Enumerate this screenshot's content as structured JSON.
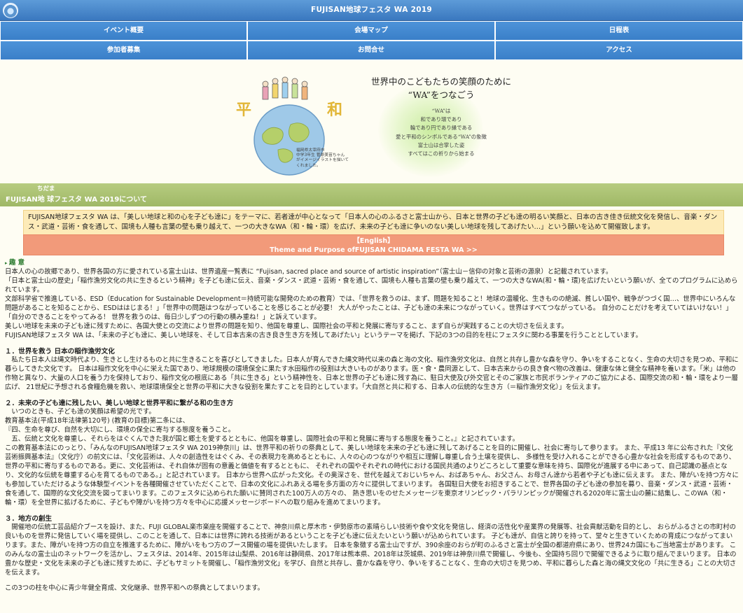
{
  "header": {
    "title": "FUJISAN地球フェスタ WA 2019",
    "logo_icon": "site-logo-icon"
  },
  "nav": {
    "items": [
      {
        "label": "イベント概要"
      },
      {
        "label": "会場マップ"
      },
      {
        "label": "日程表"
      },
      {
        "label": "参加者募集"
      },
      {
        "label": "お問合せ"
      },
      {
        "label": "アクセス"
      }
    ]
  },
  "hero": {
    "tagline": [
      "世界中のこどもたちの笑顔のために",
      "“WA”をつなごう"
    ],
    "poem": [
      "“WA”は",
      "和であり環であり",
      "輪であり円であり縁である",
      "愛と平和のシンボルである“WA”の象徴",
      "富士山は合掌した姿",
      "すべてはこの祈りから始まる"
    ],
    "illustration_chars": [
      "平",
      "和"
    ],
    "credit": [
      "福岡県太宰府市",
      "中学3年生 菅原美苗ちゃん",
      "がイメージイラストを描いて",
      "くれました。"
    ]
  },
  "about": {
    "ruby": "ちだま",
    "title": "FUJISAN地 球フェスタ WA 2019について",
    "intro": "FUJISAN地球フェスタ WA は、「美しい地球と和の心を子ども達に」をテーマに、若者達が中心となって「日本人の心のふるさと富士山から、日本と世界の子ども達の明るい笑顔と、日本の古き佳き伝統文化を発信し、音楽・ダンス・武道・芸術・食を通して、国境も人種も言葉の壁も乗り越えて、一つの大きなWA（和・輪・環）を広げ、未来の子ども達に争いのない美しい地球を残してあげたい…」という願いを込めて開催致します。",
    "english_label": "【English】",
    "english_link": "Theme and Purpose ofFUJISAN CHIDAMA FESTA WA >>"
  },
  "purpose": {
    "heading": "趣 意",
    "paragraphs": [
      "日本人の心の故郷であり、世界各国の方に愛されている富士山は、世界遺産一覧表に “Fujisan, sacred place and source of artistic inspiration”（富士山－信仰の対象と芸術の源泉）と記載されています。",
      "「日本と富士山の歴史」「稲作漁労文化の共に生きるという精神」を子ども達に伝え、音楽・ダンス・武道・芸術・食を通して、国境も人種も言葉の壁も乗り越えて、一つの大きなWA(和・輪・環)を広げたいという願いが、全てのプログラムに込められています。",
      "文部科学省で推進している、ESD（Education for Sustainable Development＝持続可能な開発のための教育）では、「世界を救うのは、まず、問題を知ること！地球の温暖化、生きものの絶滅、貧しい国や、戦争がつづく国…、世界中にいろんな問題があることを知ることから、ESDははじまる！」「世界中の問題はつながっていることを感じることが必要！ 大人がやったことは、子ども達の未来につながっていく。世界はすべてつながっている。 自分のことだけを考えていてはいけない！」「自分のできることをやってみる！ 世界を救うのは、毎日少しずつの行動の積み重ね！」と訴えています。",
      "美しい地球を未来の子ども達に残すために、各国大使との交流により世界の問題を知り、他国を尊重し、国際社会の平和と発展に寄与すること、まず自らが実践することの大切さを伝えます。",
      "FUJISAN地球フェスタ WA は、「未来の子ども達に、美しい地球を、そして日本古来の古き良き生き方を残してあげたい」というテーマを掲げ、下記の3つの目的を柱にフェスタに関わる事業を行うこととしています。"
    ]
  },
  "sections": [
    {
      "title": "１．世界を救う 日本の稲作漁労文化",
      "paragraphs": [
        "　私たち日本人は縄文時代より、生きとし生けるものと共に生きることを喜びとしてきました。日本人が育んできた縄文時代以来の森と海の文化、稲作漁労文化は、自然と共存し豊かな森を守り、争いをすることなく、生命の大切さを見つめ、平和に暮らしてきた文化です。 日本は稲作文化を中心に栄えた国であり、地球規模の環境保全に果たす水田稲作の役割は大きいものがあります。医・食・農同源として、日本古来からの良き食べ物の改善は、健康な体と健全な精神を養います。「米」は他の作物と異なり、大量の人口を養う力を保持しており、稲作文化の根底にある「共に生きる」という精神性を、日本と世界の子ども達に残す為に、駐日大使及び外交官とそのご家族と市民ボランティアのご協力による、国際交流の和・輪・環をより一層広げ、 21世紀に予想される食糧危機を救い、地球環境保全と世界の平和に大きな役割を果たすことを目的としています。「大自然と共に和する、日本人の伝統的な生き方（＝稲作漁労文化）」を伝えます。"
      ]
    },
    {
      "title": "２．未来の子ども達に残したい、美しい地球と世界平和に繋がる和の生き方",
      "paragraphs": [
        "　いつのときも、子ども達の笑顔は希望の光です。",
        "教育基本法(平成18年法律第120号) (教育の目標)第二条には、",
        "『四、生命を尊び、自然を大切にし、環境の保全に寄与する態度を養うこと。",
        "　五、伝統と文化を尊重し、それらをはぐくんできた我が国と郷土を愛するとともに、他国を尊重し、国際社会の平和と発展に寄与する態度を養うこと。』と記されています。",
        "この教育基本法にのっとり、「みんなのFUJISAN地球フェスタ WA 2019神奈川」は、世界平和の祈りの祭典として、美しい地球を未来の子ども達に残してあげることを目的に開催し、社会に寄与して参ります。 また、平成13 年に公布された『文化芸術振興基本法』（文化庁）の前文には、「文化芸術は、人々の創造性をはぐくみ、その表現力を高めるとともに、人々の心のつながりや相互に理解し尊重し合う土壌を提供し、 多様性を受け入れることができる心豊かな社会を形成するものであり、世界の平和に寄与するものである。更に、文化芸術は、それ自体が固有の意義と価値を有するとともに、 それぞれの国やそれぞれの時代における国民共通のよりどころとして重要な意味を持ち、国際化が進展する中にあって、自己認識の基点となり、文化的な伝統を尊重する心を育てるものである。」と記されています。 日本から世界へ広がった文化。その奥深さを、世代を越えておじいちゃん、おばあちゃん、お父さん、お母さん達から若者や子ども達に伝えます。 また、障がいを持つ方々にも参加していただけるような体験型イベントを各種開催させていただくことで、日本の文化にふれあえる場を多方面の方々に提供してまいります。 各国駐日大使をお招きすることで、世界各国の子ども達の参加を募り、音楽・ダンス・武道・芸術・食を通して、国際的な文化交流を図ってまいります。このフェスタに込められた願いに賛同された100万人の方々の、 熱き思いをのせたメッセージを東京オリンピック・パラリンピックが開催される2020年に富士山の麓に結集し、このWA（和・輪・環）を全世界に拡げるために、子どもや障がいを持つ方々を中心に応援メッセージボードへの取り組みを進めてまいります。"
      ]
    },
    {
      "title": "３．地方の創生",
      "paragraphs": [
        "　開催地の伝統工芸品紹介ブースを設け、また、FUJI GLOBAL楽市楽座を開催することで、神奈川県と厚木市・伊勢原市の素晴らしい技術や食や文化を発信し、経済の活性化や産業界の発展等、社会貢献活動を目的とし、 おらがふるさとの市町村の良いものを世界に発信していく場を提供し、このことを通して、日本には世界に誇れる技術があるということを子ども達に伝えたいという願いが込められています。 子ども達が、自信と誇りを持って、堂々と生きていくための育成につながってまいります。また、障がいを持つ方の自立を推進するために、障がいをもつ方のブース開催の場を提供いたします。 日本を象徴する富士山ですが、390余座のおらが町のふるさと富士が全国の都道府県にあり、世界24カ国にもご当地富士があります。 このみんなの富士山のネットワークを活かし、フェスタは、2014年、2015年は山梨県、2016年は静岡県、2017年は熊本県、2018年は茨城県、2019年は神奈川県で開催し、今後も、全国持ち回りで開催できるように取り組んでまいります。 日本の豊かな歴史・文化を未来の子ども達に残すために、子どもサミットを開催し、「稲作漁労文化」を学び、自然と共存し、豊かな森を守り、争いをすることなく、生命の大切さを見つめ、平和に暮らした森と海の縄文文化の「共に生きる」ことの大切さを伝えます。"
      ]
    }
  ],
  "closing": "この3つの柱を中心に青少年健全育成、文化継承、世界平和への祭典としてまいります。",
  "colors": {
    "topbar": "#3a78bf",
    "nav": "#4d93d9",
    "about_header": "#a9c070",
    "intro_box": "#fdebb8",
    "english_button": "#f29a7a",
    "purpose_heading": "#2e7d32"
  }
}
